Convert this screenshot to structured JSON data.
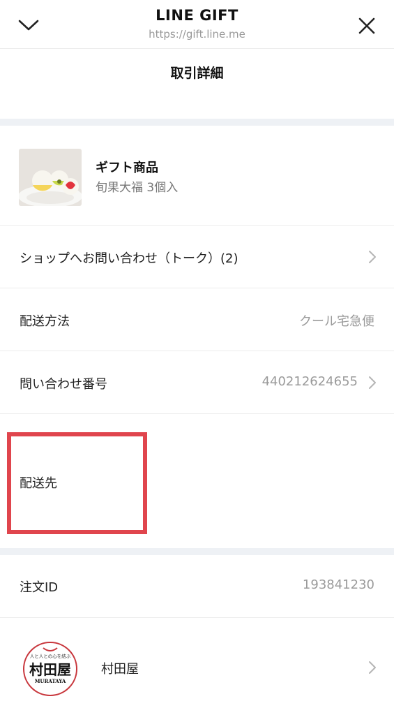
{
  "header": {
    "title": "LINE GIFT",
    "url": "https://gift.line.me"
  },
  "page": {
    "title": "取引詳細"
  },
  "gift": {
    "title": "ギフト商品",
    "subtitle": "旬果大福 3個入"
  },
  "rows": {
    "contact_shop": {
      "label": "ショップへお問い合わせ（トーク）(2)"
    },
    "delivery_method": {
      "label": "配送方法",
      "value": "クール宅急便"
    },
    "inquiry_number": {
      "label": "問い合わせ番号",
      "value": "440212624655"
    },
    "destination": {
      "label": "配送先"
    },
    "order_id": {
      "label": "注文ID",
      "value": "193841230"
    }
  },
  "shop": {
    "name": "村田屋",
    "logo_text": "村田屋",
    "logo_sub": "MURATAYA",
    "logo_top": "人と人との心を結ぶ"
  },
  "colors": {
    "highlight": "#e0454d",
    "separator": "#eef1f5"
  }
}
